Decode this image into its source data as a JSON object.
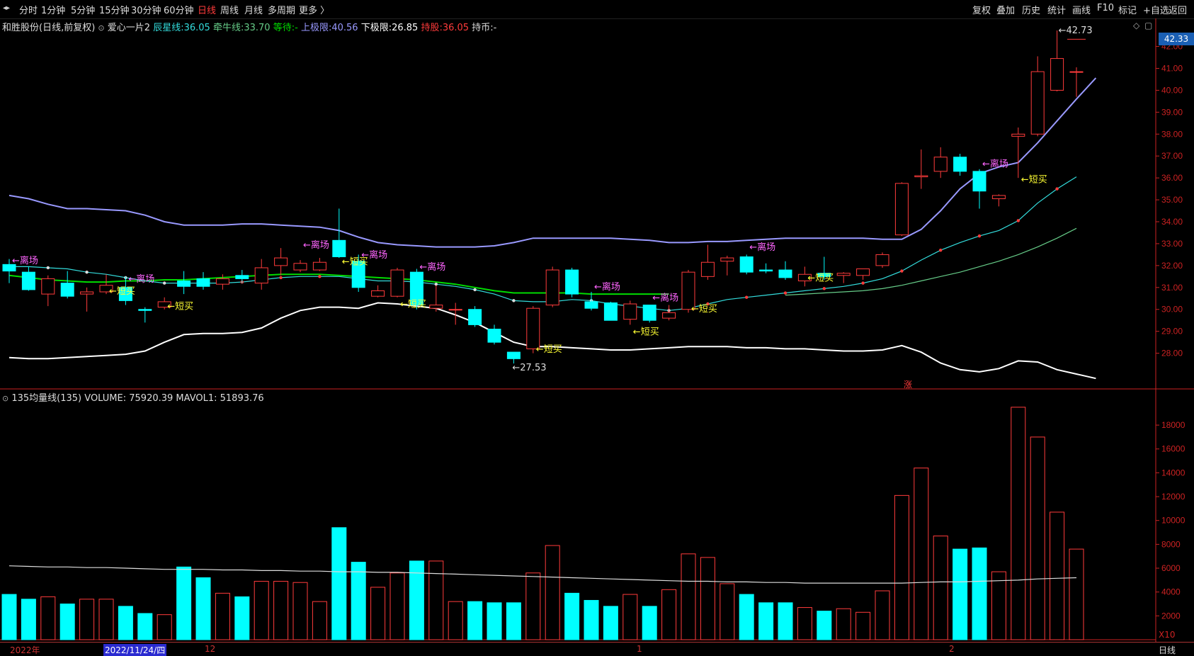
{
  "toolbar": {
    "nav": "◂▸",
    "periods": [
      "分时",
      "1分钟",
      "5分钟",
      "15分钟",
      "30分钟",
      "60分钟",
      "日线",
      "周线",
      "月线",
      "多周期",
      "更多 〉"
    ],
    "active_period": "日线",
    "right_buttons": [
      "复权",
      "叠加",
      "历史",
      "统计",
      "画线",
      "F10",
      "标记",
      "+自选",
      "返回"
    ]
  },
  "info": {
    "stock": "和胜股份(日线,前复权)",
    "indicator": "爱心一片2",
    "chenxing_label": "辰星线:",
    "chenxing_value": "36.05",
    "qianniu_label": "牵牛线:",
    "qianniu_value": "33.70",
    "dengdai_label": "等待:",
    "dengdai_value": "-",
    "upper_label": "上极限:",
    "upper_value": "40.56",
    "lower_label": "下极限:",
    "lower_value": "26.85",
    "hold_label": "持股:",
    "hold_value": "36.05",
    "coin_label": "持币:",
    "coin_value": "-"
  },
  "volume_info": {
    "name": "135均量线(135)",
    "volume_label": "VOLUME:",
    "volume_value": "75920.39",
    "mavol_label": "MAVOL1:",
    "mavol_value": "51893.76"
  },
  "price_pill": "42.33",
  "bottom": {
    "dates": [
      "2022年",
      "2022/11/24/四",
      "12",
      "1",
      "2"
    ],
    "x10": "X10",
    "period_tab": "日线"
  },
  "colors": {
    "up": "#ff3b3b",
    "down": "#00ffff",
    "upper": "#9999ff",
    "lower": "#ffffff",
    "green": "#00dd00",
    "chenxing": "#33dddd",
    "qianniu": "#66cc88",
    "signal_buy": "#ffff33",
    "signal_exit": "#ff66ff",
    "axis": "#cc2222"
  },
  "chart_data": {
    "type": "candlestick",
    "price_axis": {
      "ylim": [
        26.5,
        42.6
      ],
      "ticks": [
        28,
        29,
        30,
        31,
        32,
        33,
        34,
        35,
        36,
        37,
        38,
        39,
        40,
        41,
        42
      ],
      "tick_labels": [
        "28.00",
        "29.00",
        "30.00",
        "31.00",
        "32.00",
        "33.00",
        "34.00",
        "35.00",
        "36.00",
        "37.00",
        "38.00",
        "39.00",
        "40.00",
        "41.00",
        "42.00"
      ]
    },
    "candles": [
      {
        "o": 32.05,
        "c": 31.75,
        "h": 32.3,
        "l": 31.2
      },
      {
        "o": 31.7,
        "c": 30.9,
        "h": 31.95,
        "l": 30.85
      },
      {
        "o": 30.7,
        "c": 31.4,
        "h": 31.55,
        "l": 30.15
      },
      {
        "o": 31.2,
        "c": 30.6,
        "h": 31.75,
        "l": 30.5
      },
      {
        "o": 30.7,
        "c": 30.8,
        "h": 31.0,
        "l": 29.9
      },
      {
        "o": 30.8,
        "c": 31.1,
        "h": 31.6,
        "l": 30.7
      },
      {
        "o": 31.0,
        "c": 30.4,
        "h": 31.5,
        "l": 30.2
      },
      {
        "o": 30.0,
        "c": 29.95,
        "h": 30.1,
        "l": 29.4
      },
      {
        "o": 30.1,
        "c": 30.35,
        "h": 30.55,
        "l": 30.0
      },
      {
        "o": 31.3,
        "c": 31.05,
        "h": 31.75,
        "l": 30.7
      },
      {
        "o": 31.4,
        "c": 31.05,
        "h": 31.7,
        "l": 30.9
      },
      {
        "o": 31.15,
        "c": 31.4,
        "h": 31.6,
        "l": 30.9
      },
      {
        "o": 31.55,
        "c": 31.4,
        "h": 31.8,
        "l": 31.2
      },
      {
        "o": 31.2,
        "c": 31.9,
        "h": 32.3,
        "l": 30.9
      },
      {
        "o": 32.0,
        "c": 32.35,
        "h": 32.8,
        "l": 31.55
      },
      {
        "o": 31.8,
        "c": 32.1,
        "h": 32.25,
        "l": 31.7
      },
      {
        "o": 31.8,
        "c": 32.15,
        "h": 32.35,
        "l": 31.75
      },
      {
        "o": 33.15,
        "c": 32.4,
        "h": 34.6,
        "l": 32.35
      },
      {
        "o": 32.2,
        "c": 31.0,
        "h": 32.5,
        "l": 30.8
      },
      {
        "o": 30.6,
        "c": 30.85,
        "h": 31.1,
        "l": 30.55
      },
      {
        "o": 30.6,
        "c": 31.8,
        "h": 31.9,
        "l": 30.55
      },
      {
        "o": 31.7,
        "c": 30.2,
        "h": 31.85,
        "l": 30.0
      },
      {
        "o": 30.05,
        "c": 30.2,
        "h": 31.1,
        "l": 29.9
      },
      {
        "o": 30.0,
        "c": 30.0,
        "h": 30.3,
        "l": 29.3
      },
      {
        "o": 30.0,
        "c": 29.3,
        "h": 30.15,
        "l": 29.2
      },
      {
        "o": 29.1,
        "c": 28.5,
        "h": 29.3,
        "l": 28.4
      },
      {
        "o": 28.05,
        "c": 27.75,
        "h": 28.05,
        "l": 27.53
      },
      {
        "o": 28.2,
        "c": 30.05,
        "h": 30.15,
        "l": 28.0
      },
      {
        "o": 30.2,
        "c": 31.8,
        "h": 31.95,
        "l": 30.1
      },
      {
        "o": 31.8,
        "c": 30.7,
        "h": 31.9,
        "l": 30.55
      },
      {
        "o": 30.35,
        "c": 30.05,
        "h": 30.8,
        "l": 29.95
      },
      {
        "o": 30.3,
        "c": 29.5,
        "h": 30.35,
        "l": 29.5
      },
      {
        "o": 29.55,
        "c": 30.25,
        "h": 30.4,
        "l": 29.3
      },
      {
        "o": 30.2,
        "c": 29.5,
        "h": 30.2,
        "l": 29.4
      },
      {
        "o": 29.6,
        "c": 29.85,
        "h": 30.2,
        "l": 29.5
      },
      {
        "o": 30.0,
        "c": 31.7,
        "h": 31.8,
        "l": 29.85
      },
      {
        "o": 31.5,
        "c": 32.15,
        "h": 32.95,
        "l": 31.35
      },
      {
        "o": 32.2,
        "c": 32.35,
        "h": 32.45,
        "l": 31.55
      },
      {
        "o": 32.4,
        "c": 31.7,
        "h": 32.5,
        "l": 31.6
      },
      {
        "o": 31.8,
        "c": 31.75,
        "h": 32.1,
        "l": 31.65
      },
      {
        "o": 31.8,
        "c": 31.45,
        "h": 32.2,
        "l": 31.35
      },
      {
        "o": 31.3,
        "c": 31.6,
        "h": 31.95,
        "l": 31.05
      },
      {
        "o": 31.65,
        "c": 31.5,
        "h": 32.4,
        "l": 31.35
      },
      {
        "o": 31.55,
        "c": 31.65,
        "h": 31.7,
        "l": 31.2
      },
      {
        "o": 31.55,
        "c": 31.85,
        "h": 31.85,
        "l": 31.35
      },
      {
        "o": 32.0,
        "c": 32.5,
        "h": 32.6,
        "l": 31.9
      },
      {
        "o": 33.4,
        "c": 35.75,
        "h": 35.8,
        "l": 33.35
      },
      {
        "o": 36.05,
        "c": 36.1,
        "h": 37.3,
        "l": 35.5
      },
      {
        "o": 36.3,
        "c": 36.95,
        "h": 37.4,
        "l": 36.0
      },
      {
        "o": 36.95,
        "c": 36.3,
        "h": 37.1,
        "l": 36.1
      },
      {
        "o": 36.3,
        "c": 35.4,
        "h": 36.4,
        "l": 34.6
      },
      {
        "o": 35.05,
        "c": 35.2,
        "h": 35.25,
        "l": 34.7
      },
      {
        "o": 37.9,
        "c": 38.0,
        "h": 38.3,
        "l": 36.0
      },
      {
        "o": 38.0,
        "c": 40.85,
        "h": 41.55,
        "l": 37.9
      },
      {
        "o": 40.0,
        "c": 41.45,
        "h": 42.73,
        "l": 39.95
      },
      {
        "o": 40.85,
        "c": 40.85,
        "h": 41.05,
        "l": 39.7
      }
    ],
    "upper_line": [
      35.2,
      35.05,
      34.8,
      34.6,
      34.6,
      34.55,
      34.5,
      34.3,
      34.0,
      33.85,
      33.85,
      33.85,
      33.9,
      33.9,
      33.85,
      33.8,
      33.75,
      33.6,
      33.3,
      33.05,
      32.95,
      32.9,
      32.85,
      32.85,
      32.85,
      32.9,
      33.05,
      33.25,
      33.25,
      33.25,
      33.25,
      33.25,
      33.2,
      33.15,
      33.05,
      33.05,
      33.1,
      33.1,
      33.15,
      33.2,
      33.25,
      33.25,
      33.25,
      33.25,
      33.25,
      33.2,
      33.2,
      33.65,
      34.5,
      35.5,
      36.2,
      36.5,
      36.7,
      37.6,
      38.6,
      39.6,
      40.56
    ],
    "lower_line": [
      27.8,
      27.75,
      27.75,
      27.8,
      27.85,
      27.9,
      27.95,
      28.1,
      28.5,
      28.85,
      28.9,
      28.9,
      28.95,
      29.15,
      29.6,
      29.95,
      30.1,
      30.1,
      30.05,
      30.3,
      30.25,
      30.15,
      30.05,
      29.75,
      29.4,
      28.95,
      28.5,
      28.3,
      28.3,
      28.25,
      28.2,
      28.15,
      28.15,
      28.2,
      28.25,
      28.3,
      28.3,
      28.3,
      28.25,
      28.25,
      28.2,
      28.2,
      28.15,
      28.1,
      28.1,
      28.15,
      28.35,
      28.05,
      27.55,
      27.25,
      27.15,
      27.3,
      27.65,
      27.6,
      27.25,
      27.05,
      26.85
    ],
    "green_line": [
      31.55,
      31.45,
      31.35,
      31.3,
      31.25,
      31.25,
      31.3,
      31.3,
      31.35,
      31.35,
      31.4,
      31.45,
      31.5,
      31.55,
      31.6,
      31.6,
      31.6,
      31.55,
      31.5,
      31.45,
      31.4,
      31.35,
      31.25,
      31.15,
      31.0,
      30.85,
      30.75,
      30.75,
      30.75,
      30.75,
      30.7,
      30.7,
      30.7,
      30.7,
      30.7
    ],
    "chenxing_line": [
      31.95,
      31.95,
      31.9,
      31.85,
      31.7,
      31.6,
      31.45,
      31.3,
      31.2,
      31.2,
      31.2,
      31.2,
      31.25,
      31.35,
      31.45,
      31.5,
      31.5,
      31.5,
      31.4,
      31.3,
      31.3,
      31.25,
      31.15,
      31.05,
      30.9,
      30.7,
      30.4,
      30.35,
      30.35,
      30.45,
      30.4,
      30.25,
      30.15,
      30.05,
      29.95,
      30.05,
      30.25,
      30.45,
      30.55,
      30.65,
      30.75,
      30.85,
      30.95,
      31.05,
      31.2,
      31.4,
      31.75,
      32.25,
      32.7,
      33.05,
      33.35,
      33.6,
      34.05,
      34.85,
      35.5,
      36.05
    ],
    "qianniu_line": [
      null,
      null,
      null,
      null,
      null,
      null,
      null,
      null,
      null,
      null,
      null,
      null,
      null,
      null,
      null,
      null,
      null,
      null,
      null,
      null,
      null,
      null,
      null,
      null,
      null,
      null,
      null,
      null,
      null,
      null,
      null,
      null,
      null,
      null,
      null,
      null,
      null,
      null,
      null,
      null,
      30.65,
      30.7,
      30.75,
      30.8,
      30.85,
      30.95,
      31.1,
      31.3,
      31.5,
      31.7,
      31.95,
      32.2,
      32.5,
      32.85,
      33.25,
      33.7
    ],
    "signals": [
      {
        "i": 0,
        "price": 32.1,
        "text": "←离场",
        "kind": "exit"
      },
      {
        "i": 5,
        "price": 30.7,
        "text": "←短买",
        "kind": "buy"
      },
      {
        "i": 6,
        "price": 31.25,
        "text": "←离场",
        "kind": "exit"
      },
      {
        "i": 8,
        "price": 30.0,
        "text": "←短买",
        "kind": "buy"
      },
      {
        "i": 15,
        "price": 32.8,
        "text": "←离场",
        "kind": "exit"
      },
      {
        "i": 17,
        "price": 32.05,
        "text": "←短买",
        "kind": "buy"
      },
      {
        "i": 18,
        "price": 32.35,
        "text": "←离场",
        "kind": "exit"
      },
      {
        "i": 20,
        "price": 30.1,
        "text": "←短买",
        "kind": "buy"
      },
      {
        "i": 21,
        "price": 31.8,
        "text": "←离场",
        "kind": "exit"
      },
      {
        "i": 27,
        "price": 28.05,
        "text": "←短买",
        "kind": "buy"
      },
      {
        "i": 30,
        "price": 30.9,
        "text": "←离场",
        "kind": "exit"
      },
      {
        "i": 32,
        "price": 28.85,
        "text": "←短买",
        "kind": "buy"
      },
      {
        "i": 33,
        "price": 30.4,
        "text": "←离场",
        "kind": "exit"
      },
      {
        "i": 35,
        "price": 29.9,
        "text": "←短买",
        "kind": "buy"
      },
      {
        "i": 38,
        "price": 32.7,
        "text": "←离场",
        "kind": "exit"
      },
      {
        "i": 41,
        "price": 31.3,
        "text": "←短买",
        "kind": "buy"
      },
      {
        "i": 50,
        "price": 36.5,
        "text": "←离场",
        "kind": "exit"
      },
      {
        "i": 52,
        "price": 35.8,
        "text": "←短买",
        "kind": "buy"
      }
    ],
    "max_label": "42.73",
    "min_label": "27.53",
    "zhang_label": "涨",
    "volume": {
      "values": [
        3800,
        3400,
        3600,
        3000,
        3400,
        3400,
        2800,
        2200,
        2100,
        6100,
        5200,
        3900,
        3600,
        4900,
        4900,
        4800,
        3200,
        9400,
        6500,
        4400,
        5600,
        6600,
        6600,
        3200,
        3200,
        3100,
        3100,
        5600,
        7900,
        3900,
        3300,
        2800,
        3800,
        2800,
        4200,
        7200,
        6900,
        4700,
        3800,
        3100,
        3100,
        2700,
        2400,
        2600,
        2300,
        4100,
        12100,
        14400,
        8700,
        7600,
        7700,
        5700,
        19500,
        17000,
        10700,
        7600
      ],
      "mavol": [
        6200,
        6150,
        6100,
        6100,
        6050,
        6050,
        6000,
        5950,
        5900,
        5900,
        5900,
        5850,
        5850,
        5800,
        5800,
        5750,
        5750,
        5700,
        5700,
        5650,
        5650,
        5600,
        5550,
        5500,
        5450,
        5400,
        5350,
        5300,
        5250,
        5200,
        5150,
        5100,
        5050,
        5000,
        4950,
        4900,
        4900,
        4850,
        4850,
        4800,
        4800,
        4750,
        4750,
        4750,
        4750,
        4750,
        4750,
        4800,
        4850,
        4850,
        4900,
        4950,
        5000,
        5100,
        5150,
        5200
      ],
      "ylim": [
        0,
        20500
      ],
      "ticks": [
        2000,
        4000,
        6000,
        8000,
        10000,
        12000,
        14000,
        16000,
        18000
      ],
      "tick_labels": [
        "2000",
        "4000",
        "6000",
        "8000",
        "10000",
        "12000",
        "14000",
        "16000",
        "18000"
      ]
    }
  }
}
